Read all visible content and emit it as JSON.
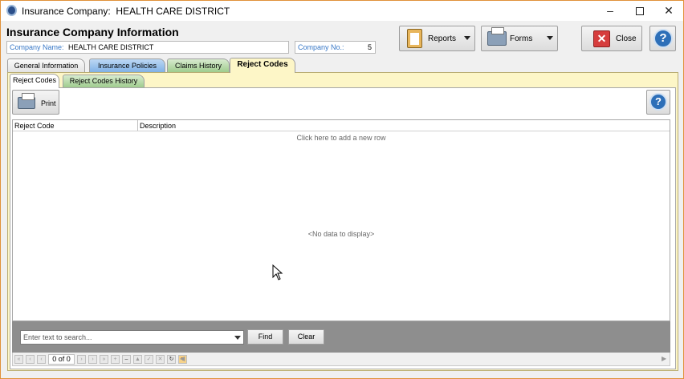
{
  "window": {
    "title_prefix": "Insurance Company:",
    "title_company": "HEALTH CARE DISTRICT",
    "minimize_icon": "minimize-icon",
    "maximize_icon": "maximize-icon",
    "close_icon": "close-icon"
  },
  "header": {
    "title": "Insurance Company Information",
    "company_name_label": "Company Name:",
    "company_name_value": "HEALTH CARE DISTRICT",
    "company_no_label": "Company No.:",
    "company_no_value": "5"
  },
  "toolbar": {
    "reports_label": "Reports",
    "forms_label": "Forms",
    "close_label": "Close"
  },
  "tabs": [
    {
      "label": "General Information"
    },
    {
      "label": "Insurance Policies"
    },
    {
      "label": "Claims History"
    },
    {
      "label": "Reject Codes"
    }
  ],
  "subtabs": [
    {
      "label": "Reject Codes"
    },
    {
      "label": "Reject Codes History"
    }
  ],
  "subtoolbar": {
    "print_label": "Print"
  },
  "grid": {
    "columns": [
      "Reject Code",
      "Description"
    ],
    "add_row_text": "Click here to add a new row",
    "empty_text": "<No data to display>"
  },
  "search": {
    "placeholder": "Enter text to search...",
    "find_label": "Find",
    "clear_label": "Clear"
  },
  "navigator": {
    "count": "0 of 0"
  },
  "colors": {
    "accent_blue": "#3878c7",
    "tab_yellow": "#fdf6c7",
    "tab_blue": "#80b1e6",
    "tab_green": "#9fcc8e"
  }
}
